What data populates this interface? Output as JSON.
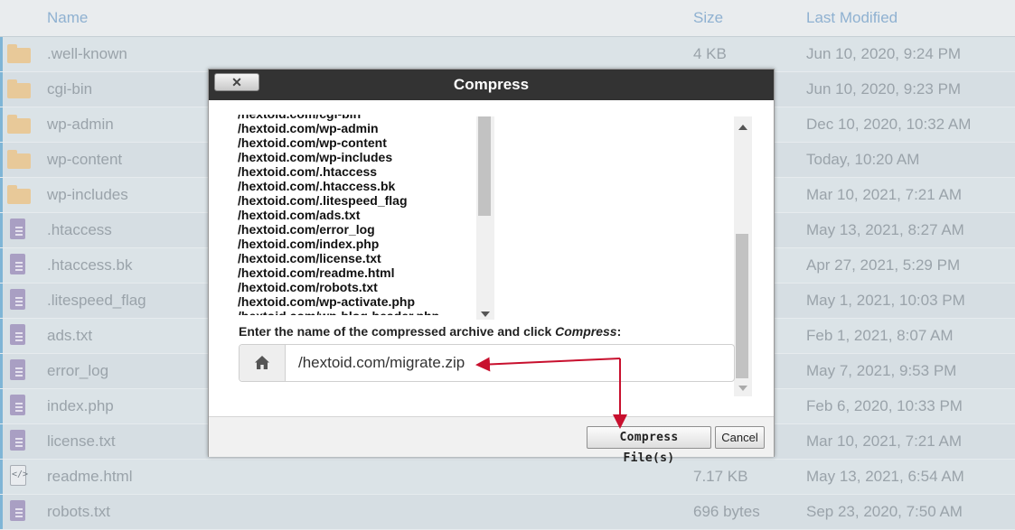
{
  "table": {
    "headers": {
      "name": "Name",
      "size": "Size",
      "modified": "Last Modified"
    },
    "rows": [
      {
        "icon": "folder-icon",
        "name": ".well-known",
        "size": "4 KB",
        "date": "Jun 10, 2020, 9:24 PM"
      },
      {
        "icon": "folder-icon",
        "name": "cgi-bin",
        "size": "",
        "date": "Jun 10, 2020, 9:23 PM"
      },
      {
        "icon": "folder-icon",
        "name": "wp-admin",
        "size": "",
        "date": "Dec 10, 2020, 10:32 AM"
      },
      {
        "icon": "folder-icon",
        "name": "wp-content",
        "size": "",
        "date": "Today, 10:20 AM"
      },
      {
        "icon": "folder-icon",
        "name": "wp-includes",
        "size": "",
        "date": "Mar 10, 2021, 7:21 AM"
      },
      {
        "icon": "file-icon",
        "name": ".htaccess",
        "size": "",
        "date": "May 13, 2021, 8:27 AM"
      },
      {
        "icon": "file-icon",
        "name": ".htaccess.bk",
        "size": "",
        "date": "Apr 27, 2021, 5:29 PM"
      },
      {
        "icon": "file-icon",
        "name": ".litespeed_flag",
        "size": "",
        "date": "May 1, 2021, 10:03 PM"
      },
      {
        "icon": "file-icon",
        "name": "ads.txt",
        "size": "",
        "date": "Feb 1, 2021, 8:07 AM"
      },
      {
        "icon": "file-icon",
        "name": "error_log",
        "size": "",
        "date": "May 7, 2021, 9:53 PM"
      },
      {
        "icon": "file-icon",
        "name": "index.php",
        "size": "",
        "date": "Feb 6, 2020, 10:33 PM"
      },
      {
        "icon": "file-icon",
        "name": "license.txt",
        "size": "",
        "date": "Mar 10, 2021, 7:21 AM"
      },
      {
        "icon": "html-file-icon",
        "name": "readme.html",
        "size": "7.17 KB",
        "date": "May 13, 2021, 6:54 AM"
      },
      {
        "icon": "file-icon",
        "name": "robots.txt",
        "size": "696 bytes",
        "date": "Sep 23, 2020, 7:50 AM"
      }
    ]
  },
  "dialog": {
    "title": "Compress",
    "close_label": "✕",
    "files": [
      "/hextoid.com/cgi-bin",
      "/hextoid.com/wp-admin",
      "/hextoid.com/wp-content",
      "/hextoid.com/wp-includes",
      "/hextoid.com/.htaccess",
      "/hextoid.com/.htaccess.bk",
      "/hextoid.com/.litespeed_flag",
      "/hextoid.com/ads.txt",
      "/hextoid.com/error_log",
      "/hextoid.com/index.php",
      "/hextoid.com/license.txt",
      "/hextoid.com/readme.html",
      "/hextoid.com/robots.txt",
      "/hextoid.com/wp-activate.php",
      "/hextoid.com/wp-blog-header.php"
    ],
    "prompt_before": "Enter the name of the compressed archive and click ",
    "prompt_em": "Compress",
    "prompt_after": ":",
    "archive_value": "/hextoid.com/migrate.zip",
    "home_icon": "home-icon",
    "compress_button": "Compress File(s)",
    "cancel_button": "Cancel"
  },
  "colors": {
    "title_bar": "#333333",
    "header_text": "#8fb1d1",
    "annotation": "#c8102e",
    "folder": "#e8c999",
    "file": "#a99fc3"
  }
}
